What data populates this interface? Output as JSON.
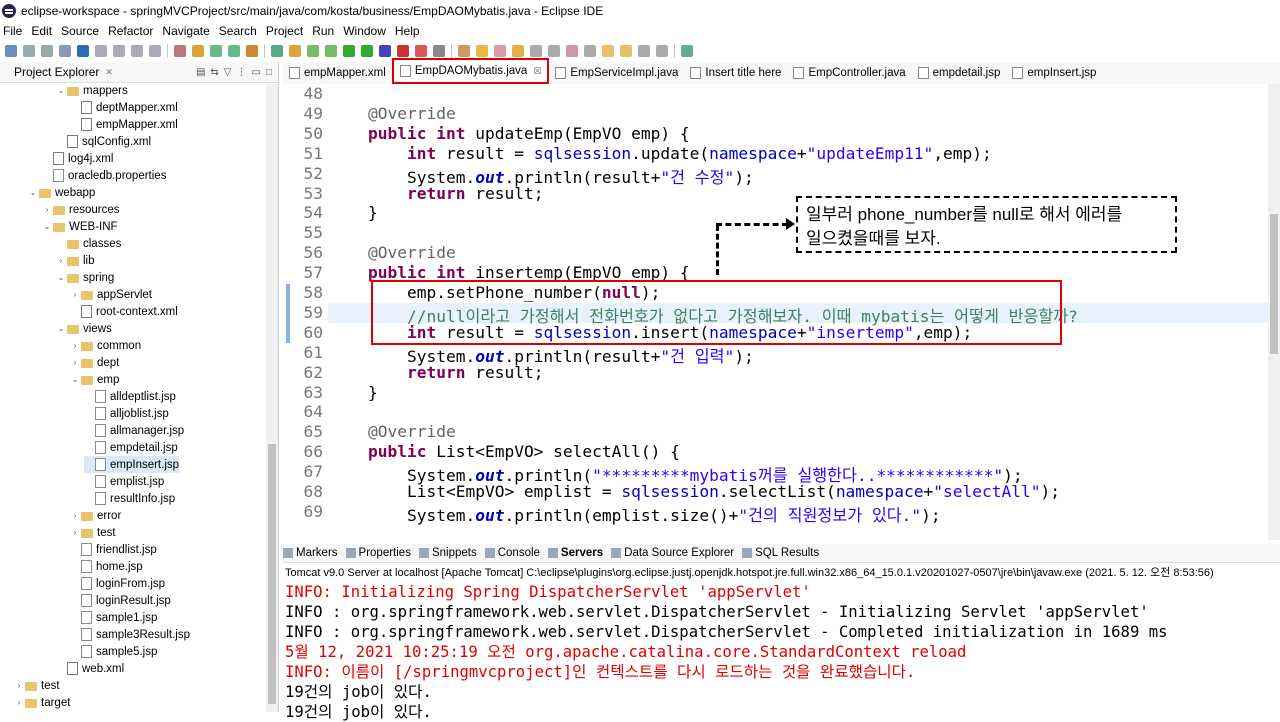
{
  "window": {
    "title": "eclipse-workspace - springMVCProject/src/main/java/com/kosta/business/EmpDAOMybatis.java - Eclipse IDE"
  },
  "menu": [
    "File",
    "Edit",
    "Source",
    "Refactor",
    "Navigate",
    "Search",
    "Project",
    "Run",
    "Window",
    "Help"
  ],
  "explorer": {
    "title": "Project Explorer",
    "items": [
      {
        "label": "mappers",
        "level": 4,
        "type": "folder",
        "open": true
      },
      {
        "label": "deptMapper.xml",
        "level": 5,
        "type": "xml"
      },
      {
        "label": "empMapper.xml",
        "level": 5,
        "type": "xml"
      },
      {
        "label": "sqlConfig.xml",
        "level": 4,
        "type": "xml"
      },
      {
        "label": "log4j.xml",
        "level": 3,
        "type": "xml"
      },
      {
        "label": "oracledb.properties",
        "level": 3,
        "type": "file"
      },
      {
        "label": "webapp",
        "level": 2,
        "type": "folder",
        "open": true
      },
      {
        "label": "resources",
        "level": 3,
        "type": "folder",
        "open": false
      },
      {
        "label": "WEB-INF",
        "level": 3,
        "type": "folder",
        "open": true
      },
      {
        "label": "classes",
        "level": 4,
        "type": "folder"
      },
      {
        "label": "lib",
        "level": 4,
        "type": "folder",
        "open": false
      },
      {
        "label": "spring",
        "level": 4,
        "type": "folder",
        "open": true
      },
      {
        "label": "appServlet",
        "level": 5,
        "type": "folder",
        "open": false
      },
      {
        "label": "root-context.xml",
        "level": 5,
        "type": "xml"
      },
      {
        "label": "views",
        "level": 4,
        "type": "folder",
        "open": true
      },
      {
        "label": "common",
        "level": 5,
        "type": "folder",
        "open": false
      },
      {
        "label": "dept",
        "level": 5,
        "type": "folder",
        "open": false
      },
      {
        "label": "emp",
        "level": 5,
        "type": "folder",
        "open": true
      },
      {
        "label": "alldeptlist.jsp",
        "level": 6,
        "type": "file"
      },
      {
        "label": "alljoblist.jsp",
        "level": 6,
        "type": "file"
      },
      {
        "label": "allmanager.jsp",
        "level": 6,
        "type": "file"
      },
      {
        "label": "empdetail.jsp",
        "level": 6,
        "type": "file"
      },
      {
        "label": "empInsert.jsp",
        "level": 6,
        "type": "file",
        "selected": true
      },
      {
        "label": "emplist.jsp",
        "level": 6,
        "type": "file"
      },
      {
        "label": "resultInfo.jsp",
        "level": 6,
        "type": "file"
      },
      {
        "label": "error",
        "level": 5,
        "type": "folder",
        "open": false
      },
      {
        "label": "test",
        "level": 5,
        "type": "folder",
        "open": false
      },
      {
        "label": "friendlist.jsp",
        "level": 5,
        "type": "file"
      },
      {
        "label": "home.jsp",
        "level": 5,
        "type": "file"
      },
      {
        "label": "loginFrom.jsp",
        "level": 5,
        "type": "file"
      },
      {
        "label": "loginResult.jsp",
        "level": 5,
        "type": "file"
      },
      {
        "label": "sample1.jsp",
        "level": 5,
        "type": "file"
      },
      {
        "label": "sample3Result.jsp",
        "level": 5,
        "type": "file"
      },
      {
        "label": "sample5.jsp",
        "level": 5,
        "type": "file"
      },
      {
        "label": "web.xml",
        "level": 4,
        "type": "xml"
      },
      {
        "label": "test",
        "level": 1,
        "type": "folder",
        "open": false
      },
      {
        "label": "target",
        "level": 1,
        "type": "folder",
        "open": false
      }
    ]
  },
  "editor_tabs": [
    {
      "label": "empMapper.xml"
    },
    {
      "label": "EmpDAOMybatis.java",
      "active": true,
      "close": "☒"
    },
    {
      "label": "EmpServiceImpl.java"
    },
    {
      "label": "Insert title here"
    },
    {
      "label": "EmpController.java"
    },
    {
      "label": "empdetail.jsp"
    },
    {
      "label": "empInsert.jsp"
    }
  ],
  "code_lines": [
    {
      "n": "48",
      "html": ""
    },
    {
      "n": "49",
      "html": "<span class='ann'>@Override</span>"
    },
    {
      "n": "50",
      "html": "<span class='kw'>public</span> <span class='kw'>int</span> updateEmp(EmpVO emp) {"
    },
    {
      "n": "51",
      "html": "    <span class='kw'>int</span> result = <span class='fld'>sqlsession</span>.update(<span class='fld'>namespace</span>+<span class='str'>\"updateEmp11\"</span>,emp);"
    },
    {
      "n": "52",
      "html": "    System.<span class='sfld'>out</span>.println(result+<span class='str'>\"건 수정\"</span>);"
    },
    {
      "n": "53",
      "html": "    <span class='kw'>return</span> result;"
    },
    {
      "n": "54",
      "html": "}"
    },
    {
      "n": "55",
      "html": ""
    },
    {
      "n": "56",
      "html": "<span class='ann'>@Override</span>"
    },
    {
      "n": "57",
      "html": "<span class='kw'>public</span> <span class='kw'>int</span> insertemp(EmpVO emp) {"
    },
    {
      "n": "58",
      "html": "    emp.setPhone_number(<span class='kw'>null</span>);"
    },
    {
      "n": "59",
      "html": "    <span class='cmt'>//null이라고 가정해서 전화번호가 없다고 가정해보자. 이때 mybatis는 어떻게 반응할까?</span>"
    },
    {
      "n": "60",
      "html": "    <span class='kw'>int</span> result = <span class='fld'>sqlsession</span>.insert(<span class='fld'>namespace</span>+<span class='str'>\"insertemp\"</span>,emp);"
    },
    {
      "n": "61",
      "html": "    System.<span class='sfld'>out</span>.println(result+<span class='str'>\"건 입력\"</span>);"
    },
    {
      "n": "62",
      "html": "    <span class='kw'>return</span> result;"
    },
    {
      "n": "63",
      "html": "}"
    },
    {
      "n": "64",
      "html": ""
    },
    {
      "n": "65",
      "html": "<span class='ann'>@Override</span>"
    },
    {
      "n": "66",
      "html": "<span class='kw'>public</span> List&lt;EmpVO&gt; selectAll() {"
    },
    {
      "n": "67",
      "html": "    System.<span class='sfld'>out</span>.println(<span class='str'>\"*********mybatis꺼를 실행한다..************\"</span>);"
    },
    {
      "n": "68",
      "html": "    List&lt;EmpVO&gt; emplist = <span class='fld'>sqlsession</span>.selectList(<span class='fld'>namespace</span>+<span class='str'>\"selectAll\"</span>);"
    },
    {
      "n": "69",
      "html": "    System.<span class='sfld'>out</span>.println(emplist.size()+<span class='str'>\"건의 직원정보가 있다.\"</span>);"
    }
  ],
  "annotation_note": {
    "line1": "일부러 phone_number를 null로 해서 에러를",
    "line2": "일으켰을때를 보자."
  },
  "console": {
    "tabs": [
      {
        "label": "Markers"
      },
      {
        "label": "Properties"
      },
      {
        "label": "Snippets"
      },
      {
        "label": "Console"
      },
      {
        "label": "Servers",
        "active": true
      },
      {
        "label": "Data Source Explorer"
      },
      {
        "label": "SQL Results"
      }
    ],
    "status": "Tomcat v9.0 Server at localhost [Apache Tomcat] C:\\eclipse\\plugins\\org.eclipse.justj.openjdk.hotspot.jre.full.win32.x86_64_15.0.1.v20201027-0507\\jre\\bin\\javaw.exe  (2021. 5. 12. 오전 8:53:56)",
    "lines": [
      {
        "text": "INFO: Initializing Spring DispatcherServlet 'appServlet'",
        "color": "red"
      },
      {
        "text": "INFO : org.springframework.web.servlet.DispatcherServlet - Initializing Servlet 'appServlet'",
        "color": "blk"
      },
      {
        "text": "INFO : org.springframework.web.servlet.DispatcherServlet - Completed initialization in 1689 ms",
        "color": "blk"
      },
      {
        "text": "5월 12, 2021 10:25:19 오전 org.apache.catalina.core.StandardContext reload",
        "color": "red"
      },
      {
        "text": "INFO: 이름이 [/springmvcproject]인 컨텍스트를 다시 로드하는 것을 완료했습니다.",
        "color": "red"
      },
      {
        "text": "19건의 job이 있다.",
        "color": "blk"
      },
      {
        "text": "19건의 job이 있다.",
        "color": "blk"
      }
    ]
  }
}
